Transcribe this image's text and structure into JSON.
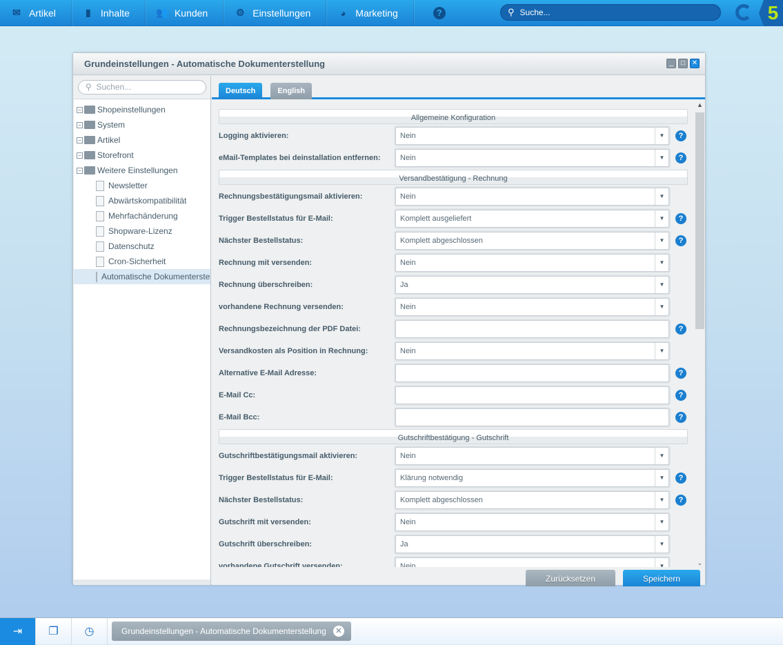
{
  "topbar": {
    "nav": [
      {
        "label": "Artikel",
        "icon": "inbox-icon"
      },
      {
        "label": "Inhalte",
        "icon": "document-icon"
      },
      {
        "label": "Kunden",
        "icon": "users-icon"
      },
      {
        "label": "Einstellungen",
        "icon": "gear-icon"
      },
      {
        "label": "Marketing",
        "icon": "pie-chart-icon"
      }
    ],
    "search_placeholder": "Suche...",
    "logo": "5"
  },
  "window": {
    "title": "Grundeinstellungen - Automatische Dokumenterstellung",
    "left": {
      "search_placeholder": "Suchen...",
      "tree": [
        {
          "label": "Shopeinstellungen",
          "type": "folder"
        },
        {
          "label": "System",
          "type": "folder"
        },
        {
          "label": "Artikel",
          "type": "folder"
        },
        {
          "label": "Storefront",
          "type": "folder"
        },
        {
          "label": "Weitere Einstellungen",
          "type": "folder"
        },
        {
          "label": "Newsletter",
          "type": "leaf"
        },
        {
          "label": "Abwärtskompatibilität",
          "type": "leaf"
        },
        {
          "label": "Mehrfachänderung",
          "type": "leaf"
        },
        {
          "label": "Shopware-Lizenz",
          "type": "leaf"
        },
        {
          "label": "Datenschutz",
          "type": "leaf"
        },
        {
          "label": "Cron-Sicherheit",
          "type": "leaf"
        },
        {
          "label": "Automatische Dokumenterstellung",
          "type": "leaf",
          "selected": true
        }
      ]
    },
    "tabs": [
      {
        "label": "Deutsch",
        "active": true
      },
      {
        "label": "English",
        "active": false
      }
    ],
    "sections": [
      {
        "title": "Allgemeine Konfiguration",
        "fields": [
          {
            "label": "Logging aktivieren:",
            "value": "Nein",
            "select": true,
            "help": true
          },
          {
            "label": "eMail-Templates bei deinstallation entfernen:",
            "value": "Nein",
            "select": true,
            "help": true
          }
        ]
      },
      {
        "title": "Versandbestätigung - Rechnung",
        "fields": [
          {
            "label": "Rechnungsbestätigungsmail aktivieren:",
            "value": "Nein",
            "select": true,
            "help": false
          },
          {
            "label": "Trigger Bestellstatus für E-Mail:",
            "value": "Komplett ausgeliefert",
            "select": true,
            "help": true
          },
          {
            "label": "Nächster Bestellstatus:",
            "value": "Komplett abgeschlossen",
            "select": true,
            "help": true
          },
          {
            "label": "Rechnung mit versenden:",
            "value": "Nein",
            "select": true,
            "help": false
          },
          {
            "label": "Rechnung überschreiben:",
            "value": "Ja",
            "select": true,
            "help": false
          },
          {
            "label": "vorhandene Rechnung versenden:",
            "value": "Nein",
            "select": true,
            "help": false
          },
          {
            "label": "Rechnungsbezeichnung der PDF Datei:",
            "value": "",
            "select": false,
            "help": true
          },
          {
            "label": "Versandkosten als Position in Rechnung:",
            "value": "Nein",
            "select": true,
            "help": false
          },
          {
            "label": "Alternative E-Mail Adresse:",
            "value": "",
            "select": false,
            "help": true
          },
          {
            "label": "E-Mail Cc:",
            "value": "",
            "select": false,
            "help": true
          },
          {
            "label": "E-Mail Bcc:",
            "value": "",
            "select": false,
            "help": true
          }
        ]
      },
      {
        "title": "Gutschriftbestätigung - Gutschrift",
        "fields": [
          {
            "label": "Gutschriftbestätigungsmail aktivieren:",
            "value": "Nein",
            "select": true,
            "help": false
          },
          {
            "label": "Trigger Bestellstatus für E-Mail:",
            "value": "Klärung notwendig",
            "select": true,
            "help": true
          },
          {
            "label": "Nächster Bestellstatus:",
            "value": "Komplett abgeschlossen",
            "select": true,
            "help": true
          },
          {
            "label": "Gutschrift mit versenden:",
            "value": "Nein",
            "select": true,
            "help": false
          },
          {
            "label": "Gutschrift überschreiben:",
            "value": "Ja",
            "select": true,
            "help": false
          },
          {
            "label": "vorhandene Gutschrift versenden:",
            "value": "Nein",
            "select": true,
            "help": false
          }
        ]
      }
    ],
    "buttons": {
      "reset": "Zurücksetzen",
      "save": "Speichern"
    }
  },
  "taskbar": {
    "task": "Grundeinstellungen - Automatische Dokumenterstellung"
  }
}
